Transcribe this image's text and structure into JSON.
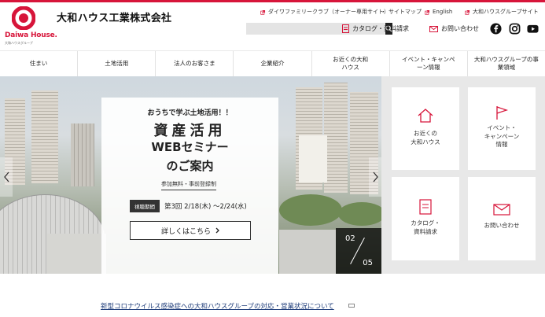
{
  "header": {
    "logo_name": "Daiwa House.",
    "logo_sub": "大和ハウスグループ",
    "company_name": "大和ハウス工業株式会社",
    "util_links": [
      {
        "label": "ダイワファミリークラブ（オーナー専用サイト）"
      },
      {
        "label": "サイトマップ"
      },
      {
        "label": "English"
      },
      {
        "label": "大和ハウスグループサイト"
      }
    ],
    "search": {
      "placeholder": "",
      "value": ""
    },
    "catalog_label": "カタログ・資料請求",
    "contact_label": "お問い合わせ",
    "social": [
      "facebook-icon",
      "instagram-icon",
      "youtube-icon"
    ]
  },
  "nav": {
    "items": [
      {
        "label": "住まい"
      },
      {
        "label": "土地活用"
      },
      {
        "label": "法人のお客さま"
      },
      {
        "label": "企業紹介"
      },
      {
        "label": "お近くの大和ハウス"
      },
      {
        "label": "イベント・キャンペーン情報"
      },
      {
        "label": "大和ハウスグループの事業領域"
      }
    ]
  },
  "hero": {
    "kicker": "おうちで学ぶ土地活用！！",
    "title_line1": "資産活用",
    "title_line2": "WEBセミナー",
    "title_line3": "のご案内",
    "note": "参加無料・事前登録制",
    "period_tag": "視聴期間",
    "period_text": "第3回  2/18(木) 〜2/24(水)",
    "button_label": "詳しくはこちら",
    "slide_current": "02",
    "slide_total": "05"
  },
  "quick_links": [
    {
      "label_line1": "お近くの",
      "label_line2": "大和ハウス",
      "label_line3": "",
      "icon": "house-icon"
    },
    {
      "label_line1": "イベント・",
      "label_line2": "キャンペーン",
      "label_line3": "情報",
      "icon": "flag-icon"
    },
    {
      "label_line1": "カタログ・",
      "label_line2": "資料請求",
      "label_line3": "",
      "icon": "document-icon"
    },
    {
      "label_line1": "お問い合わせ",
      "label_line2": "",
      "label_line3": "",
      "icon": "mail-icon"
    }
  ],
  "notice": {
    "link": "新型コロナウイルス感染症への大和ハウスグループの対応・営業状況について"
  },
  "colors": {
    "brand": "#d7153a",
    "link": "#1f3d7a"
  }
}
